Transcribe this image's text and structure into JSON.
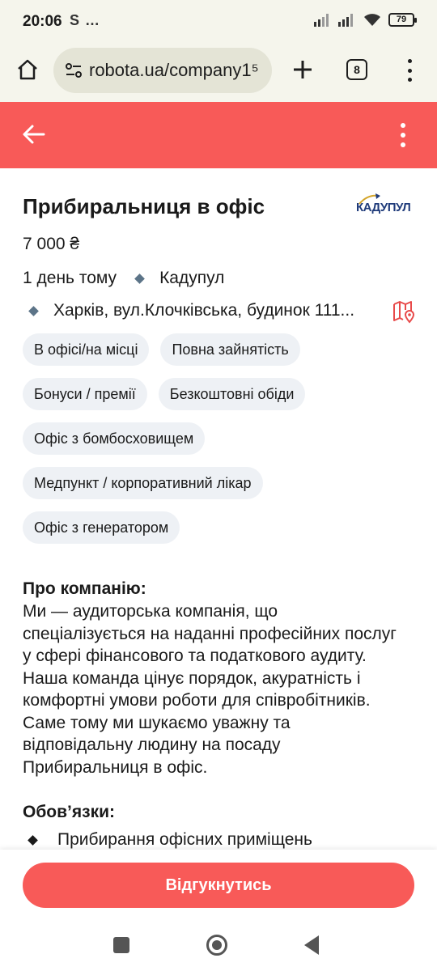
{
  "status_bar": {
    "time": "20:06",
    "extra": "S  …",
    "battery": "79"
  },
  "browser": {
    "url": "robota.ua/company1⁵",
    "tab_count": "8"
  },
  "job": {
    "title": "Прибиральниця в офіс",
    "company_logo_text": "КАДУПУЛ",
    "salary": "7 000 ₴",
    "posted": "1 день тому",
    "company": "Кадупул",
    "address": "Харків, вул.Клочківська, будинок 111..."
  },
  "chips": [
    "В офісі/на місці",
    "Повна зайнятість",
    "Бонуси / премії",
    "Безкоштовні обіди",
    "Офіс з бомбосховищем",
    "Медпункт / корпоративний лікар",
    "Офіс з генератором"
  ],
  "about": {
    "title": "Про компанію:",
    "text": "Ми — аудиторська компанія, що спеціалізується на наданні професійних послуг у сфері фінансового та податкового аудиту. Наша команда цінує порядок, акуратність і комфортні умови роботи для співробітників. Саме тому ми шукаємо уважну та відповідальну людину на посаду Прибиральниця в офіс."
  },
  "duties": {
    "title": "Обов’язки:",
    "items": [
      "Прибирання офісних приміщень"
    ]
  },
  "apply_label": "Відгукнутись",
  "colors": {
    "accent": "#f85a58",
    "chip_bg": "#eef1f5",
    "browser_bg": "#f5f5ec"
  },
  "icons": [
    "home-icon",
    "site-settings-icon",
    "plus-icon",
    "tabs-icon",
    "menu-icon",
    "back-arrow-icon",
    "more-vert-icon",
    "map-pin-icon"
  ]
}
